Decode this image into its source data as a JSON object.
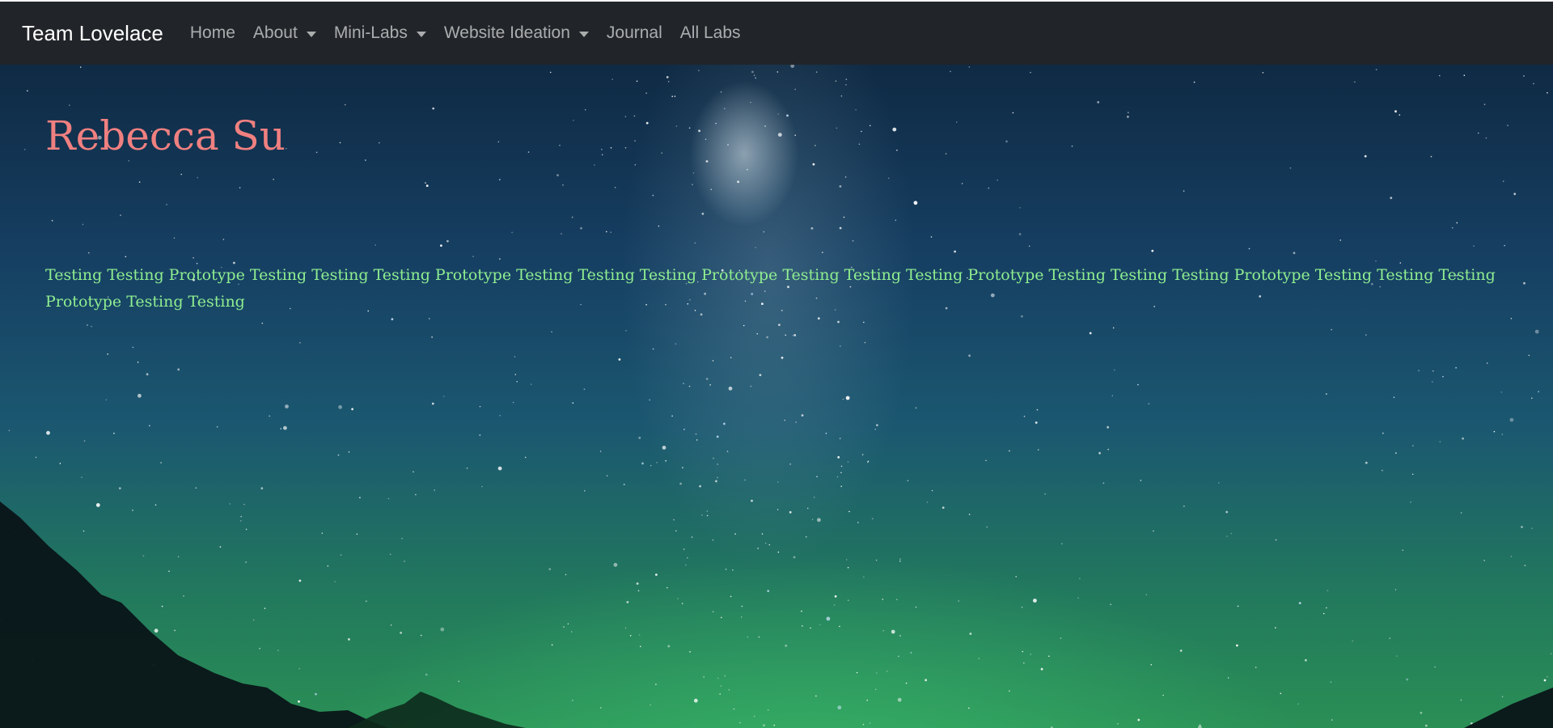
{
  "navbar": {
    "brand": "Team Lovelace",
    "items": [
      {
        "label": "Home",
        "dropdown": false
      },
      {
        "label": "About",
        "dropdown": true
      },
      {
        "label": "Mini-Labs",
        "dropdown": true
      },
      {
        "label": "Website Ideation",
        "dropdown": true
      },
      {
        "label": "Journal",
        "dropdown": false
      },
      {
        "label": "All Labs",
        "dropdown": false
      }
    ]
  },
  "main": {
    "title": "Rebecca Su",
    "paragraph": "Testing Testing Prototype Testing Testing Testing Prototype Testing Testing Testing Prototype Testing Testing Testing Prototype Testing Testing Testing Prototype Testing Testing Testing Prototype Testing Testing"
  },
  "colors": {
    "navbar_bg": "#212529",
    "title": "#f08080",
    "paragraph": "#90ee90"
  }
}
